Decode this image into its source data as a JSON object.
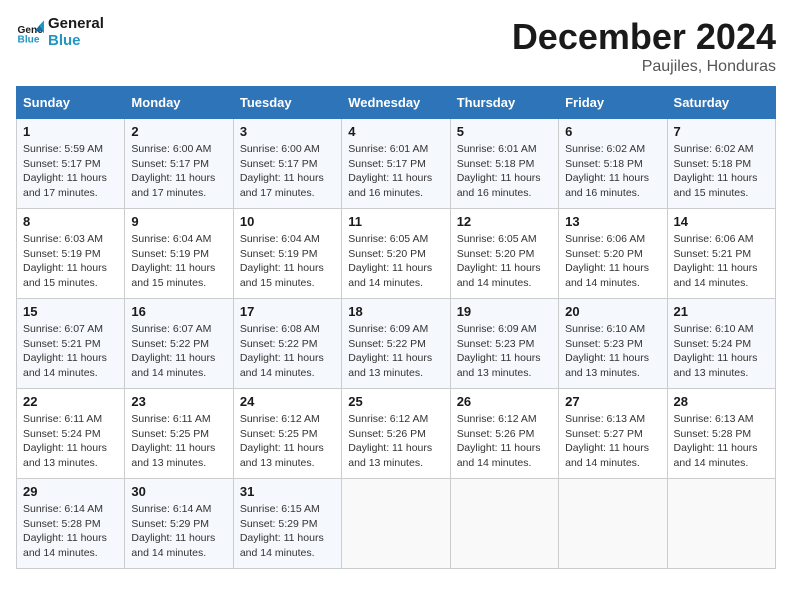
{
  "header": {
    "logo_line1": "General",
    "logo_line2": "Blue",
    "month": "December 2024",
    "location": "Paujiles, Honduras"
  },
  "days_of_week": [
    "Sunday",
    "Monday",
    "Tuesday",
    "Wednesday",
    "Thursday",
    "Friday",
    "Saturday"
  ],
  "weeks": [
    [
      {
        "day": "1",
        "sunrise": "5:59 AM",
        "sunset": "5:17 PM",
        "daylight": "11 hours and 17 minutes."
      },
      {
        "day": "2",
        "sunrise": "6:00 AM",
        "sunset": "5:17 PM",
        "daylight": "11 hours and 17 minutes."
      },
      {
        "day": "3",
        "sunrise": "6:00 AM",
        "sunset": "5:17 PM",
        "daylight": "11 hours and 17 minutes."
      },
      {
        "day": "4",
        "sunrise": "6:01 AM",
        "sunset": "5:17 PM",
        "daylight": "11 hours and 16 minutes."
      },
      {
        "day": "5",
        "sunrise": "6:01 AM",
        "sunset": "5:18 PM",
        "daylight": "11 hours and 16 minutes."
      },
      {
        "day": "6",
        "sunrise": "6:02 AM",
        "sunset": "5:18 PM",
        "daylight": "11 hours and 16 minutes."
      },
      {
        "day": "7",
        "sunrise": "6:02 AM",
        "sunset": "5:18 PM",
        "daylight": "11 hours and 15 minutes."
      }
    ],
    [
      {
        "day": "8",
        "sunrise": "6:03 AM",
        "sunset": "5:19 PM",
        "daylight": "11 hours and 15 minutes."
      },
      {
        "day": "9",
        "sunrise": "6:04 AM",
        "sunset": "5:19 PM",
        "daylight": "11 hours and 15 minutes."
      },
      {
        "day": "10",
        "sunrise": "6:04 AM",
        "sunset": "5:19 PM",
        "daylight": "11 hours and 15 minutes."
      },
      {
        "day": "11",
        "sunrise": "6:05 AM",
        "sunset": "5:20 PM",
        "daylight": "11 hours and 14 minutes."
      },
      {
        "day": "12",
        "sunrise": "6:05 AM",
        "sunset": "5:20 PM",
        "daylight": "11 hours and 14 minutes."
      },
      {
        "day": "13",
        "sunrise": "6:06 AM",
        "sunset": "5:20 PM",
        "daylight": "11 hours and 14 minutes."
      },
      {
        "day": "14",
        "sunrise": "6:06 AM",
        "sunset": "5:21 PM",
        "daylight": "11 hours and 14 minutes."
      }
    ],
    [
      {
        "day": "15",
        "sunrise": "6:07 AM",
        "sunset": "5:21 PM",
        "daylight": "11 hours and 14 minutes."
      },
      {
        "day": "16",
        "sunrise": "6:07 AM",
        "sunset": "5:22 PM",
        "daylight": "11 hours and 14 minutes."
      },
      {
        "day": "17",
        "sunrise": "6:08 AM",
        "sunset": "5:22 PM",
        "daylight": "11 hours and 14 minutes."
      },
      {
        "day": "18",
        "sunrise": "6:09 AM",
        "sunset": "5:22 PM",
        "daylight": "11 hours and 13 minutes."
      },
      {
        "day": "19",
        "sunrise": "6:09 AM",
        "sunset": "5:23 PM",
        "daylight": "11 hours and 13 minutes."
      },
      {
        "day": "20",
        "sunrise": "6:10 AM",
        "sunset": "5:23 PM",
        "daylight": "11 hours and 13 minutes."
      },
      {
        "day": "21",
        "sunrise": "6:10 AM",
        "sunset": "5:24 PM",
        "daylight": "11 hours and 13 minutes."
      }
    ],
    [
      {
        "day": "22",
        "sunrise": "6:11 AM",
        "sunset": "5:24 PM",
        "daylight": "11 hours and 13 minutes."
      },
      {
        "day": "23",
        "sunrise": "6:11 AM",
        "sunset": "5:25 PM",
        "daylight": "11 hours and 13 minutes."
      },
      {
        "day": "24",
        "sunrise": "6:12 AM",
        "sunset": "5:25 PM",
        "daylight": "11 hours and 13 minutes."
      },
      {
        "day": "25",
        "sunrise": "6:12 AM",
        "sunset": "5:26 PM",
        "daylight": "11 hours and 13 minutes."
      },
      {
        "day": "26",
        "sunrise": "6:12 AM",
        "sunset": "5:26 PM",
        "daylight": "11 hours and 14 minutes."
      },
      {
        "day": "27",
        "sunrise": "6:13 AM",
        "sunset": "5:27 PM",
        "daylight": "11 hours and 14 minutes."
      },
      {
        "day": "28",
        "sunrise": "6:13 AM",
        "sunset": "5:28 PM",
        "daylight": "11 hours and 14 minutes."
      }
    ],
    [
      {
        "day": "29",
        "sunrise": "6:14 AM",
        "sunset": "5:28 PM",
        "daylight": "11 hours and 14 minutes."
      },
      {
        "day": "30",
        "sunrise": "6:14 AM",
        "sunset": "5:29 PM",
        "daylight": "11 hours and 14 minutes."
      },
      {
        "day": "31",
        "sunrise": "6:15 AM",
        "sunset": "5:29 PM",
        "daylight": "11 hours and 14 minutes."
      },
      null,
      null,
      null,
      null
    ]
  ],
  "labels": {
    "sunrise": "Sunrise:",
    "sunset": "Sunset:",
    "daylight": "Daylight:"
  }
}
